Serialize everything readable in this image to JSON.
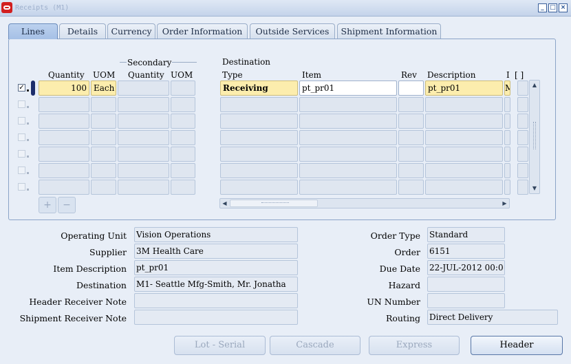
{
  "window": {
    "title": "Receipts (M1)"
  },
  "tabs": [
    {
      "label": "Lines",
      "active": true
    },
    {
      "label": "Details",
      "active": false
    },
    {
      "label": "Currency",
      "active": false
    },
    {
      "label": "Order Information",
      "active": false
    },
    {
      "label": "Outside Services",
      "active": false
    },
    {
      "label": "Shipment Information",
      "active": false
    }
  ],
  "lines": {
    "group_headers": {
      "secondary": "Secondary",
      "destination": "Destination"
    },
    "columns": {
      "quantity": "Quantity",
      "uom": "UOM",
      "sec_quantity": "Quantity",
      "sec_uom": "UOM",
      "dest_type": "Type",
      "item": "Item",
      "rev": "Rev",
      "description": "Description",
      "extra": "I",
      "bracket": "[  ]"
    },
    "row1": {
      "selected": true,
      "quantity": "100",
      "uom": "Each",
      "sec_quantity": "",
      "sec_uom": "",
      "dest_type": "Receiving",
      "item": "pt_pr01",
      "rev": "",
      "description": "pt_pr01",
      "extra": "M"
    }
  },
  "details": {
    "operating_unit": {
      "label": "Operating Unit",
      "value": "Vision Operations"
    },
    "supplier": {
      "label": "Supplier",
      "value": "3M Health Care"
    },
    "item_description": {
      "label": "Item Description",
      "value": "pt_pr01"
    },
    "destination": {
      "label": "Destination",
      "value": "M1- Seattle Mfg-Smith, Mr. Jonatha"
    },
    "header_receiver_note": {
      "label": "Header Receiver Note",
      "value": ""
    },
    "shipment_receiver_note": {
      "label": "Shipment Receiver Note",
      "value": ""
    },
    "order_type": {
      "label": "Order Type",
      "value": "Standard"
    },
    "order": {
      "label": "Order",
      "value": "6151"
    },
    "due_date": {
      "label": "Due Date",
      "value": "22-JUL-2012 00:0"
    },
    "hazard": {
      "label": "Hazard",
      "value": ""
    },
    "un_number": {
      "label": "UN Number",
      "value": ""
    },
    "routing": {
      "label": "Routing",
      "value": "Direct Delivery"
    }
  },
  "buttons": {
    "lot_serial": "Lot - Serial",
    "cascade": "Cascade",
    "express": "Express",
    "header": "Header"
  },
  "colors": {
    "required_field": "#fcedad",
    "active_tab": "#a6c0e6",
    "background": "#e8eef7"
  }
}
